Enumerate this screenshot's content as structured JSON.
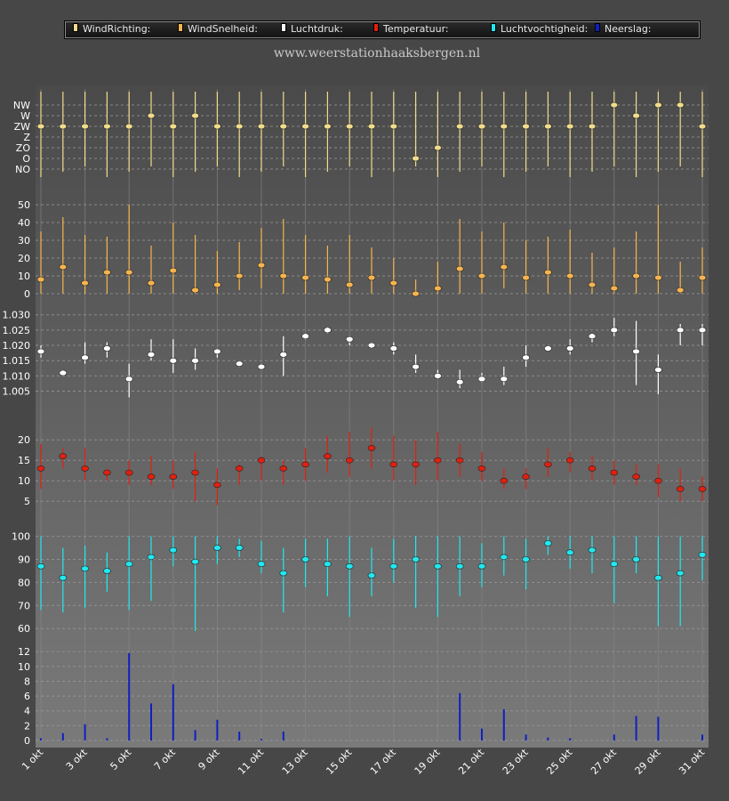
{
  "site_title": "www.weerstationhaaksbergen.nl",
  "legend": [
    {
      "label": "WindRichting:",
      "color": "#f0dc8c"
    },
    {
      "label": "WindSnelheid:",
      "color": "#f5b450"
    },
    {
      "label": "Luchtdruk:",
      "color": "#ffffff"
    },
    {
      "label": "Temperatuur:",
      "color": "#e02010"
    },
    {
      "label": "Luchtvochtigheid:",
      "color": "#20e8f0"
    },
    {
      "label": "Neerslag:",
      "color": "#1020c0"
    }
  ],
  "chart_data": {
    "type": "multi-panel",
    "x": [
      "1 okt",
      "2 okt",
      "3 okt",
      "4 okt",
      "5 okt",
      "6 okt",
      "7 okt",
      "8 okt",
      "9 okt",
      "10 okt",
      "11 okt",
      "12 okt",
      "13 okt",
      "14 okt",
      "15 okt",
      "16 okt",
      "17 okt",
      "18 okt",
      "19 okt",
      "20 okt",
      "21 okt",
      "22 okt",
      "23 okt",
      "24 okt",
      "25 okt",
      "26 okt",
      "27 okt",
      "28 okt",
      "29 okt",
      "30 okt",
      "31 okt"
    ],
    "x_tick_labels": [
      "1 okt",
      "3 okt",
      "5 okt",
      "7 okt",
      "9 okt",
      "11 okt",
      "13 okt",
      "15 okt",
      "17 okt",
      "19 okt",
      "21 okt",
      "23 okt",
      "25 okt",
      "27 okt",
      "29 okt",
      "31 okt"
    ],
    "panels": [
      {
        "name": "WindRichting",
        "color": "#f0dc8c",
        "yticks": [
          "NW",
          "W",
          "ZW",
          "Z",
          "ZO",
          "O",
          "NO"
        ],
        "values": [
          "ZW",
          "ZW",
          "ZW",
          "ZW",
          "ZW",
          "W",
          "ZW",
          "W",
          "ZW",
          "ZW",
          "ZW",
          "ZW",
          "ZW",
          "ZW",
          "ZW",
          "ZW",
          "ZW",
          "O",
          "ZO",
          "ZW",
          "ZW",
          "ZW",
          "ZW",
          "ZW",
          "ZW",
          "ZW",
          "NW",
          "W",
          "NW",
          "NW",
          "ZW"
        ]
      },
      {
        "name": "WindSnelheid",
        "color": "#f5b450",
        "yticks": [
          0,
          10,
          20,
          30,
          40,
          50
        ],
        "values": [
          8,
          15,
          6,
          12,
          12,
          6,
          13,
          2,
          5,
          10,
          16,
          10,
          9,
          8,
          5,
          9,
          6,
          0,
          3,
          14,
          10,
          15,
          9,
          12,
          10,
          5,
          3,
          10,
          9,
          2,
          9
        ],
        "low": [
          0,
          0,
          0,
          0,
          0,
          0,
          0,
          0,
          0,
          2,
          3,
          0,
          0,
          0,
          0,
          0,
          0,
          0,
          0,
          0,
          0,
          3,
          0,
          0,
          0,
          0,
          0,
          0,
          0,
          0,
          0
        ],
        "high": [
          35,
          43,
          33,
          32,
          50,
          27,
          40,
          33,
          24,
          29,
          37,
          42,
          33,
          27,
          33,
          26,
          20,
          8,
          18,
          42,
          35,
          40,
          30,
          32,
          36,
          23,
          26,
          35,
          50,
          18,
          26
        ]
      },
      {
        "name": "Luchtdruk",
        "color": "#ffffff",
        "yticks": [
          1.005,
          1.01,
          1.015,
          1.02,
          1.025,
          1.03
        ],
        "values": [
          1.018,
          1.011,
          1.016,
          1.019,
          1.009,
          1.017,
          1.015,
          1.015,
          1.018,
          1.014,
          1.013,
          1.017,
          1.023,
          1.025,
          1.022,
          1.02,
          1.019,
          1.013,
          1.01,
          1.008,
          1.009,
          1.009,
          1.016,
          1.019,
          1.019,
          1.023,
          1.025,
          1.018,
          1.012,
          1.025,
          1.025
        ],
        "low": [
          1.016,
          1.01,
          1.014,
          1.016,
          1.003,
          1.015,
          1.011,
          1.012,
          1.016,
          1.013,
          1.012,
          1.01,
          1.022,
          1.024,
          1.02,
          1.019,
          1.017,
          1.011,
          1.009,
          1.006,
          1.008,
          1.007,
          1.013,
          1.018,
          1.017,
          1.021,
          1.023,
          1.007,
          1.004,
          1.02,
          1.02
        ],
        "high": [
          1.02,
          1.012,
          1.021,
          1.021,
          1.014,
          1.022,
          1.022,
          1.019,
          1.019,
          1.015,
          1.014,
          1.023,
          1.024,
          1.026,
          1.023,
          1.021,
          1.021,
          1.017,
          1.012,
          1.012,
          1.011,
          1.013,
          1.02,
          1.02,
          1.022,
          1.024,
          1.029,
          1.028,
          1.017,
          1.027,
          1.027
        ]
      },
      {
        "name": "Temperatuur",
        "color": "#e02010",
        "yticks": [
          5,
          10,
          15,
          20
        ],
        "values": [
          13,
          16,
          13,
          12,
          12,
          11,
          11,
          12,
          9,
          13,
          15,
          13,
          14,
          16,
          15,
          18,
          14,
          14,
          15,
          15,
          13,
          10,
          11,
          14,
          15,
          13,
          12,
          11,
          10,
          8,
          8
        ],
        "low": [
          8,
          13,
          10,
          10,
          9,
          9,
          8,
          5,
          4,
          9,
          10,
          9,
          10,
          12,
          11,
          13,
          10,
          9,
          10,
          11,
          10,
          8,
          8,
          11,
          12,
          10,
          9,
          9,
          6,
          5,
          5
        ],
        "high": [
          19,
          18,
          18,
          13,
          15,
          16,
          15,
          17,
          13,
          14,
          16,
          15,
          18,
          21,
          22,
          23,
          21,
          20,
          22,
          19,
          17,
          13,
          13,
          18,
          17,
          16,
          15,
          14,
          14,
          13,
          11
        ]
      },
      {
        "name": "Luchtvochtigheid",
        "color": "#20e8f0",
        "yticks": [
          60,
          70,
          80,
          90,
          100
        ],
        "values": [
          87,
          82,
          86,
          85,
          88,
          91,
          94,
          89,
          95,
          95,
          88,
          84,
          90,
          88,
          87,
          83,
          87,
          90,
          87,
          87,
          87,
          91,
          90,
          97,
          93,
          94,
          88,
          90,
          82,
          84,
          92
        ],
        "low": [
          68,
          67,
          69,
          76,
          68,
          72,
          87,
          59,
          88,
          91,
          84,
          67,
          78,
          74,
          65,
          74,
          80,
          69,
          65,
          74,
          78,
          83,
          77,
          92,
          86,
          84,
          71,
          84,
          61,
          61,
          81
        ],
        "high": [
          100,
          95,
          96,
          93,
          100,
          100,
          100,
          100,
          100,
          99,
          98,
          95,
          99,
          99,
          100,
          95,
          99,
          100,
          100,
          100,
          97,
          100,
          99,
          100,
          100,
          100,
          100,
          100,
          100,
          100,
          100
        ]
      },
      {
        "name": "Neerslag",
        "color": "#1020c0",
        "yticks": [
          0,
          2,
          4,
          6,
          8,
          10,
          12
        ],
        "values": [
          0.3,
          1.0,
          2.2,
          0.3,
          11.8,
          5.0,
          7.6,
          1.4,
          2.8,
          1.2,
          0.2,
          1.2,
          0,
          0,
          0,
          0,
          0,
          0,
          0,
          6.4,
          1.6,
          4.2,
          0.8,
          0.4,
          0.3,
          0,
          0.8,
          3.3,
          3.2,
          0,
          0.8
        ]
      }
    ]
  }
}
